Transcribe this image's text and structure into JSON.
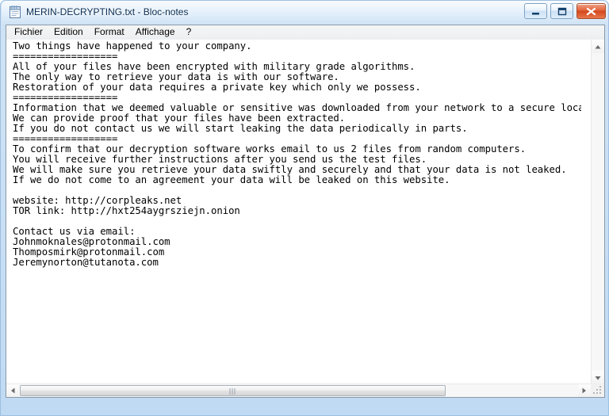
{
  "window": {
    "title": "MERIN-DECRYPTING.txt - Bloc-notes",
    "icon": "notepad-icon",
    "frame_color": "#bcd8f2",
    "controls": {
      "minimize_label": "Minimiser",
      "maximize_label": "Agrandir",
      "close_label": "Fermer"
    }
  },
  "menubar": {
    "items": [
      {
        "label": "Fichier",
        "name": "menu-file"
      },
      {
        "label": "Edition",
        "name": "menu-edit"
      },
      {
        "label": "Format",
        "name": "menu-format"
      },
      {
        "label": "Affichage",
        "name": "menu-view"
      },
      {
        "label": "?",
        "name": "menu-help"
      }
    ]
  },
  "document": {
    "filename": "MERIN-DECRYPTING.txt",
    "body": "Two things have happened to your company.\n==================\nAll of your files have been encrypted with military grade algorithms.\nThe only way to retrieve your data is with our software.\nRestoration of your data requires a private key which only we possess.\n==================\nInformation that we deemed valuable or sensitive was downloaded from your network to a secure location.\nWe can provide proof that your files have been extracted.\nIf you do not contact us we will start leaking the data periodically in parts.\n==================\nTo confirm that our decryption software works email to us 2 files from random computers.\nYou will receive further instructions after you send us the test files.\nWe will make sure you retrieve your data swiftly and securely and that your data is not leaked.\nIf we do not come to an agreement your data will be leaked on this website.\n\nwebsite: http://corpleaks.net\nTOR link: http://hxt254aygrsziejn.onion\n\nContact us via email:\nJohnmoknales@protonmail.com\nThomposmirk@protonmail.com\nJeremynorton@tutanota.com",
    "website": "http://corpleaks.net",
    "tor_link": "http://hxt254aygrsziejn.onion",
    "emails": [
      "Johnmoknales@protonmail.com",
      "Thomposmirk@protonmail.com",
      "Jeremynorton@tutanota.com"
    ],
    "separator": "==================",
    "text_color": "#000000",
    "background_color": "#ffffff"
  },
  "scrollbars": {
    "horizontal": {
      "thumb_position_percent": 0,
      "thumb_width_percent": 73
    },
    "vertical": {
      "thumb_position_percent": 0,
      "thumb_width_percent": 100
    }
  }
}
